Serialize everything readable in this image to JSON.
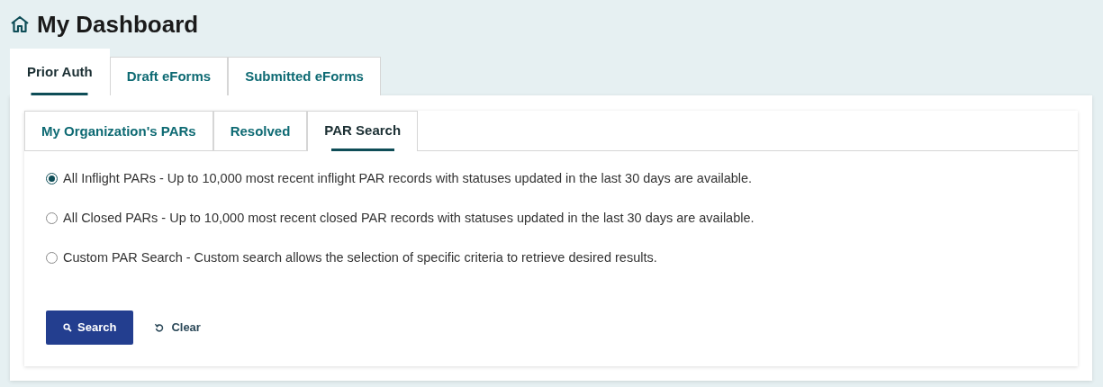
{
  "title": "My Dashboard",
  "tabs": [
    {
      "label": "Prior Auth",
      "selected": true
    },
    {
      "label": "Draft eForms",
      "selected": false
    },
    {
      "label": "Submitted eForms",
      "selected": false
    }
  ],
  "subtabs": [
    {
      "label": "My Organization's PARs",
      "selected": false
    },
    {
      "label": "Resolved",
      "selected": false
    },
    {
      "label": "PAR Search",
      "selected": true
    }
  ],
  "options": [
    {
      "label": "All Inflight PARs - Up to 10,000 most recent inflight PAR records with statuses updated in the last 30 days are available.",
      "selected": true
    },
    {
      "label": "All Closed PARs - Up to 10,000 most recent closed PAR records with statuses updated in the last 30 days are available.",
      "selected": false
    },
    {
      "label": "Custom PAR Search - Custom search allows the selection of specific criteria to retrieve desired results.",
      "selected": false
    }
  ],
  "buttons": {
    "search": "Search",
    "clear": "Clear"
  }
}
